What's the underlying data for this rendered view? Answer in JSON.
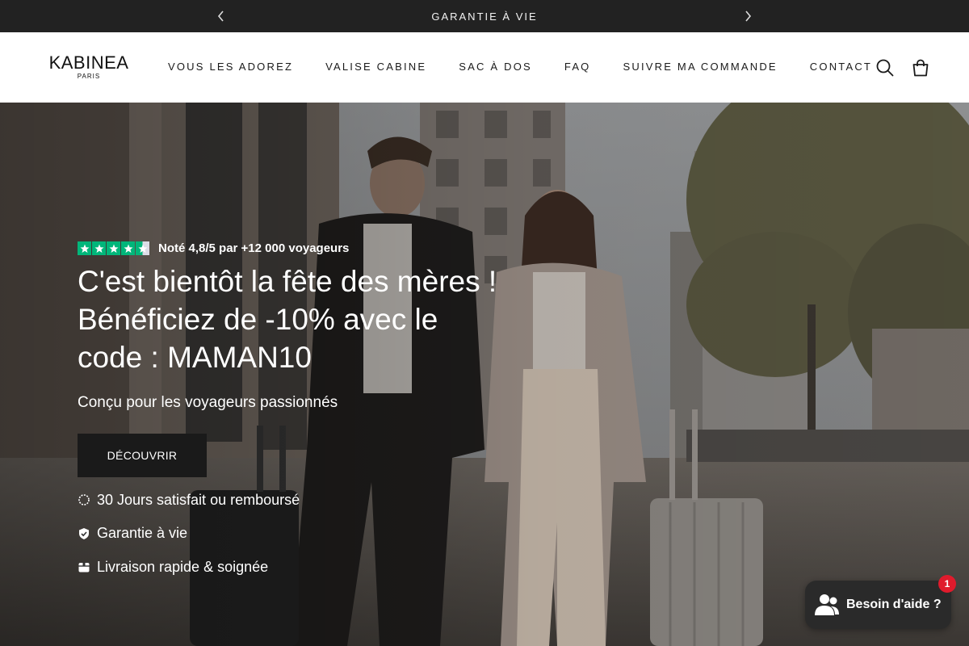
{
  "announcement": {
    "text": "GARANTIE À VIE",
    "prev_icon": "chevron-left-icon",
    "next_icon": "chevron-right-icon"
  },
  "header": {
    "logo": {
      "main": "KABINEA",
      "sub": "PARIS"
    },
    "nav": [
      {
        "label": "VOUS LES ADOREZ"
      },
      {
        "label": "VALISE CABINE"
      },
      {
        "label": "SAC À DOS"
      },
      {
        "label": "FAQ"
      },
      {
        "label": "SUIVRE MA COMMANDE"
      },
      {
        "label": "CONTACT"
      }
    ],
    "icons": [
      "search-icon",
      "shopping-bag-icon"
    ]
  },
  "hero": {
    "rating": {
      "stars": 4.5,
      "stars_out_of": 5,
      "text": "Noté 4,8/5 par +12 000 voyageurs",
      "star_color": "#00b67a"
    },
    "headline": "C'est bientôt la fête des mères ! Bénéficiez de -10% avec le code : MAMAN10",
    "subline": "Conçu pour les voyageurs passionnés",
    "cta_label": "DÉCOUVRIR",
    "features": [
      {
        "icon": "refresh-icon",
        "label": "30 Jours satisfait ou remboursé"
      },
      {
        "icon": "shield-check-icon",
        "label": "Garantie à vie"
      },
      {
        "icon": "box-icon",
        "label": "Livraison rapide & soignée"
      }
    ]
  },
  "help_widget": {
    "label": "Besoin d'aide ?",
    "badge_count": "1",
    "icon": "chat-users-icon"
  },
  "colors": {
    "announcement_bg": "#222222",
    "cta_bg": "#1a1a1a",
    "badge": "#e01b2c"
  }
}
